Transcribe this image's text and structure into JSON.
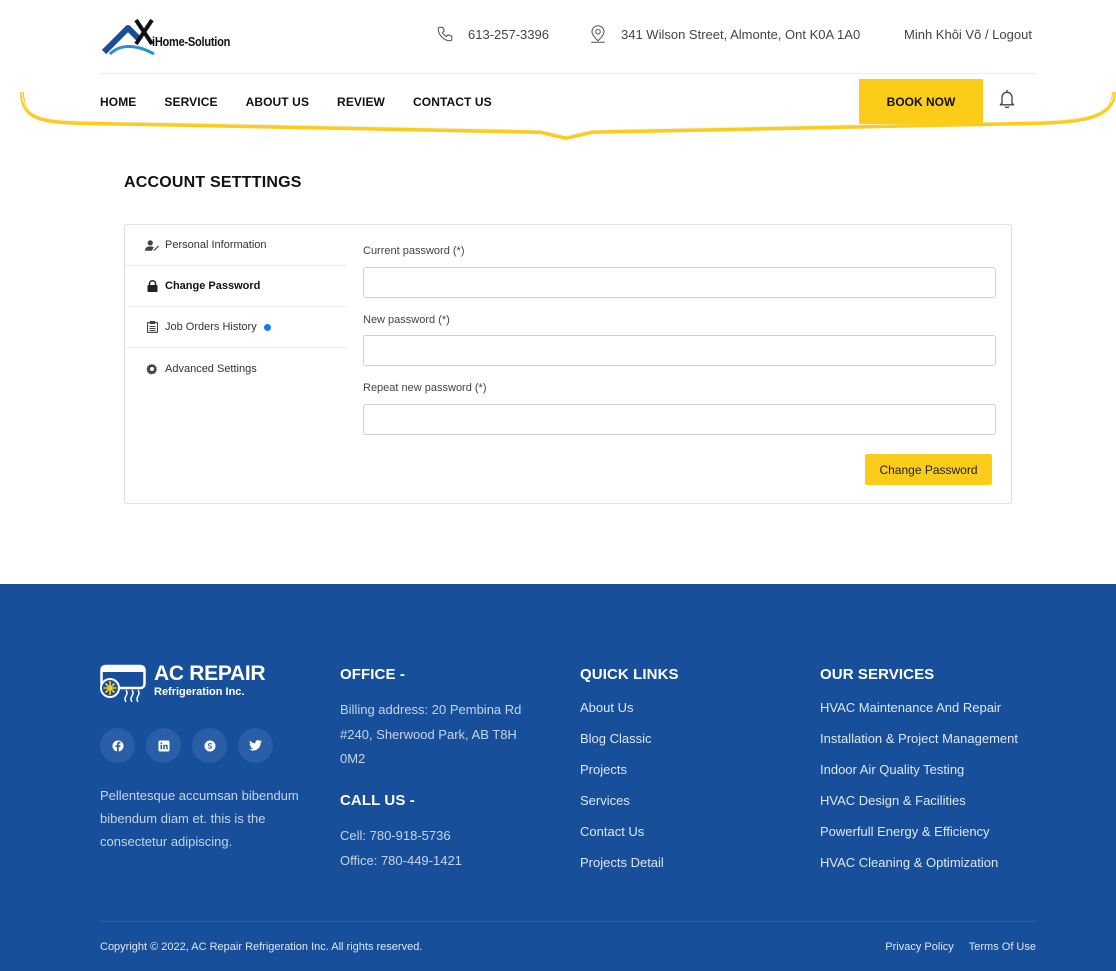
{
  "header": {
    "logo_text": "iHome-Solution",
    "phone": "613-257-3396",
    "address": "341 Wilson Street, Almonte, Ont K0A 1A0",
    "user_name": "Minh Khôi Võ",
    "user_separator": " / ",
    "logout": "Logout"
  },
  "nav": {
    "items": [
      {
        "label": "HOME"
      },
      {
        "label": "SERVICE"
      },
      {
        "label": "ABOUT US"
      },
      {
        "label": "REVIEW"
      },
      {
        "label": "CONTACT US"
      }
    ],
    "book_now": "BOOK NOW"
  },
  "page": {
    "title": "ACCOUNT SETTTINGS"
  },
  "sidebar": {
    "items": [
      {
        "label": "Personal Information",
        "icon": "user-edit-icon"
      },
      {
        "label": "Change Password",
        "icon": "lock-icon"
      },
      {
        "label": "Job Orders History",
        "icon": "clipboard-icon"
      },
      {
        "label": "Advanced Settings",
        "icon": "gear-icon"
      }
    ],
    "active": "Change Password"
  },
  "form": {
    "current_label": "Current password (*)",
    "current_value": "",
    "new_label": "New password (*)",
    "new_value": "",
    "repeat_label": "Repeat new password (*)",
    "repeat_value": "",
    "submit": "Change Password"
  },
  "footer": {
    "brand_line1": "AC REPAIR",
    "brand_line2": "Refrigeration Inc.",
    "socials": [
      "facebook-icon",
      "linkedin-icon",
      "skype-icon",
      "twitter-icon"
    ],
    "description": "Pellentesque accumsan bibendum bibendum diam et. this is the consectetur adipiscing.",
    "office_heading": "OFFICE -",
    "office_address": "Billing address: 20 Pembina Rd #240, Sherwood Park, AB T8H 0M2",
    "call_heading": "CALL US -",
    "cell": "Cell: 780-918-5736",
    "office_phone": "Office: 780-449-1421",
    "quick_links_heading": "QUICK LINKS",
    "quick_links": [
      {
        "label": "About Us"
      },
      {
        "label": "Blog Classic"
      },
      {
        "label": "Projects"
      },
      {
        "label": "Services"
      },
      {
        "label": "Contact Us"
      },
      {
        "label": "Projects Detail"
      }
    ],
    "services_heading": "OUR SERVICES",
    "services": [
      {
        "label": "HVAC Maintenance And Repair"
      },
      {
        "label": "Installation & Project Management"
      },
      {
        "label": "Indoor Air Quality Testing"
      },
      {
        "label": "HVAC Design & Facilities"
      },
      {
        "label": "Powerfull Energy & Efficiency"
      },
      {
        "label": "HVAC Cleaning & Optimization"
      }
    ],
    "copyright": "Copyright © 2022, AC Repair Refrigeration Inc. All rights reserved.",
    "privacy": "Privacy Policy",
    "terms": "Terms Of Use"
  },
  "colors": {
    "accent": "#fccc1b",
    "footer_bg": "#174f9a",
    "notification_dot": "#1877f2"
  }
}
